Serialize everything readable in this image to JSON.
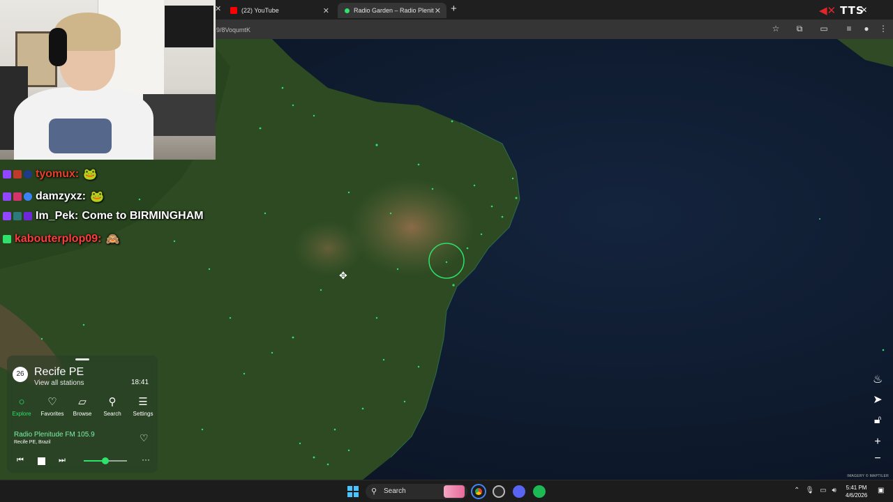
{
  "browser": {
    "tabs": [
      {
        "title": "(22) YouTube",
        "active": false
      },
      {
        "title": "Radio Garden – Radio Plenit",
        "active": true
      }
    ],
    "url": "9/8VoqumtK",
    "new_tab_icon": "plus-icon"
  },
  "overlay": {
    "tts_label": "TTS"
  },
  "chat": [
    {
      "user": "tyomux:",
      "color": "#e63f2b",
      "emote": "frog-emote"
    },
    {
      "user": "damzyxz:",
      "color": "#ffffff",
      "emote": "frog-emote"
    },
    {
      "user": "Im_Pek:",
      "color": "#ffffff",
      "message": "Come to BIRMINGHAM"
    },
    {
      "user": "kabouterplop09:",
      "color": "#ff3b3b",
      "emote": "monkey-emote"
    }
  ],
  "radio_panel": {
    "station_count": "26",
    "place": "Recife PE",
    "view_all": "View all stations",
    "local_time": "18:41",
    "nav": [
      {
        "label": "Explore",
        "icon": "explore-icon",
        "active": true
      },
      {
        "label": "Favorites",
        "icon": "heart-icon",
        "active": false
      },
      {
        "label": "Browse",
        "icon": "map-icon",
        "active": false
      },
      {
        "label": "Search",
        "icon": "search-icon",
        "active": false
      },
      {
        "label": "Settings",
        "icon": "menu-icon",
        "active": false
      }
    ],
    "now_playing": {
      "station": "Radio Plenitude FM 105.9",
      "location": "Recife PE, Brazil",
      "volume": 0.5
    }
  },
  "map": {
    "attribution": "IMAGERY © MAPTILER",
    "accent_color": "#2ee26c"
  },
  "taskbar": {
    "search_label": "Search",
    "time": "5:41 PM",
    "date": "4/6/2026"
  }
}
